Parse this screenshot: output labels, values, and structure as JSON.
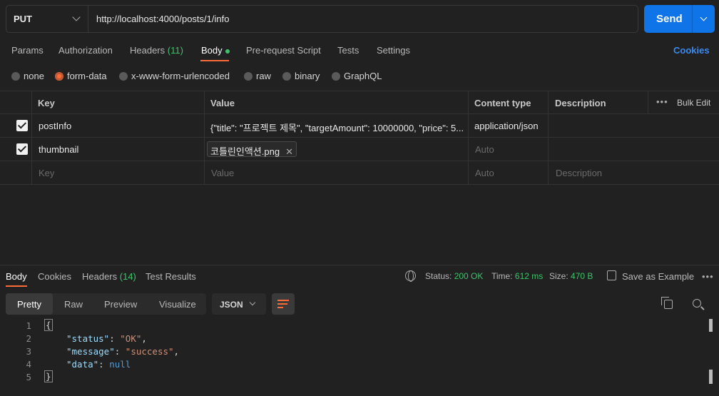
{
  "request": {
    "method": "PUT",
    "url": "http://localhost:4000/posts/1/info",
    "send_label": "Send"
  },
  "tabs": {
    "params": "Params",
    "authorization": "Authorization",
    "headers": "Headers",
    "headers_count": "(11)",
    "body": "Body",
    "pre_request": "Pre-request Script",
    "tests": "Tests",
    "settings": "Settings",
    "cookies": "Cookies"
  },
  "body_types": [
    "none",
    "form-data",
    "x-www-form-urlencoded",
    "raw",
    "binary",
    "GraphQL"
  ],
  "body_type_selected": "form-data",
  "table": {
    "headers": {
      "key": "Key",
      "value": "Value",
      "content_type": "Content type",
      "description": "Description",
      "bulk_edit": "Bulk Edit"
    },
    "rows": [
      {
        "key": "postInfo",
        "value": "{\"title\": \"프로젝트 제목\", \"targetAmount\": 10000000, \"price\": 5...",
        "content_type": "application/json",
        "checked": true
      },
      {
        "key": "thumbnail",
        "value": "코틀린인액션.png",
        "content_type": "Auto",
        "checked": true
      }
    ],
    "placeholder": {
      "key": "Key",
      "value": "Value",
      "content_type": "Auto",
      "description": "Description"
    }
  },
  "response": {
    "tabs": {
      "body": "Body",
      "cookies": "Cookies",
      "headers": "Headers",
      "headers_count": "(14)",
      "test_results": "Test Results"
    },
    "status_label": "Status:",
    "status_value": "200 OK",
    "time_label": "Time:",
    "time_value": "612 ms",
    "size_label": "Size:",
    "size_value": "470 B",
    "save_example": "Save as Example",
    "views": [
      "Pretty",
      "Raw",
      "Preview",
      "Visualize"
    ],
    "format": "JSON",
    "lines": [
      "1",
      "2",
      "3",
      "4",
      "5"
    ],
    "json": {
      "status_key": "\"status\"",
      "status_val": "\"OK\"",
      "message_key": "\"message\"",
      "message_val": "\"success\"",
      "data_key": "\"data\"",
      "data_val": "null"
    }
  },
  "colors": {
    "accent": "#ff6c37",
    "send": "#0f74e8",
    "ok": "#3cc36a",
    "link": "#3b8bf0"
  }
}
